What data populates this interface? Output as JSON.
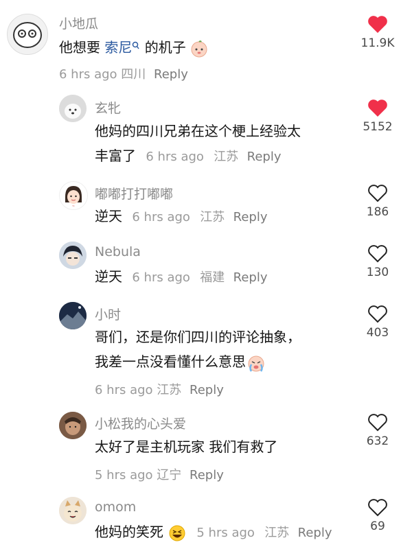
{
  "comments": [
    {
      "username": "小地瓜",
      "text_before": "他想要 ",
      "mention": "索尼",
      "text_after": " 的机子",
      "time": "6 hrs ago",
      "region": "四川",
      "reply": "Reply",
      "likes": "11.9K",
      "liked": true
    },
    {
      "username": "玄牝",
      "line1": "他妈的四川兄弟在这个梗上经验太",
      "line2": "丰富了",
      "time": "6 hrs ago",
      "region": "江苏",
      "reply": "Reply",
      "likes": "5152",
      "liked": true
    },
    {
      "username": "嘟嘟打打嘟嘟",
      "text": "逆天",
      "time": "6 hrs ago",
      "region": "江苏",
      "reply": "Reply",
      "likes": "186",
      "liked": false
    },
    {
      "username": "Nebula",
      "text": "逆天",
      "time": "6 hrs ago",
      "region": "福建",
      "reply": "Reply",
      "likes": "130",
      "liked": false
    },
    {
      "username": "小时",
      "line1": "哥们，还是你们四川的评论抽象，",
      "line2": "我差一点没看懂什么意思",
      "time": "6 hrs ago",
      "region": "江苏",
      "reply": "Reply",
      "likes": "403",
      "liked": false
    },
    {
      "username": "小松我的心头爱",
      "text": "太好了是主机玩家 我们有救了",
      "time": "5 hrs ago",
      "region": "辽宁",
      "reply": "Reply",
      "likes": "632",
      "liked": false
    },
    {
      "username": "omom",
      "text": "他妈的笑死",
      "time": "5 hrs ago",
      "region": "江苏",
      "reply": "Reply",
      "likes": "69",
      "liked": false
    }
  ],
  "colors": {
    "liked_heart": "#f0304a",
    "outline_heart": "#222222",
    "mention": "#2c5aa0"
  },
  "icons": [
    "heart-filled-icon",
    "heart-outline-icon",
    "search-icon",
    "baby-face-emoji",
    "crying-emoji",
    "laughing-emoji"
  ]
}
